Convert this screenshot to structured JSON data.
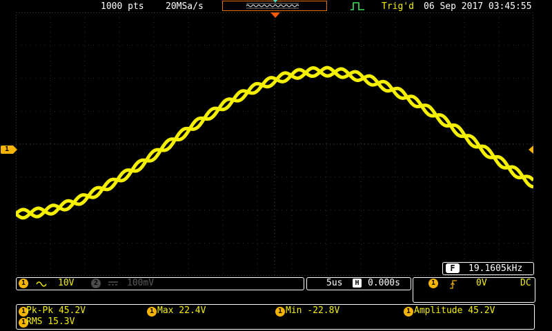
{
  "status_bar": {
    "points": "1000 pts",
    "sample_rate": "20MSa/s",
    "trigger_status": "Trig'd",
    "datetime": "06 Sep 2017 03:45:55"
  },
  "channel_marker": "1",
  "frequency": {
    "icon_label": "F",
    "value": "19.1605kHz"
  },
  "channels": {
    "ch1_label": "1",
    "ch1_coupling_icon": "ac-coupling-icon",
    "ch1_scale": "10V",
    "ch2_label": "2",
    "ch2_coupling_icon": "dc-coupling-icon",
    "ch2_scale": "100mV"
  },
  "timebase": {
    "scale": "5us",
    "horizontal_icon": "H",
    "position": "0.000s"
  },
  "trigger": {
    "source": "1",
    "slope_icon": "rising-edge-icon",
    "level": "0V",
    "coupling": "DC"
  },
  "measurements": [
    {
      "channel": "1",
      "text": "Pk-Pk 45.2V"
    },
    {
      "channel": "1",
      "text": "Max 22.4V"
    },
    {
      "channel": "1",
      "text": "Min -22.8V"
    },
    {
      "channel": "1",
      "text": "Amplitude 45.2V"
    },
    {
      "channel": "1",
      "text": "RMS 15.3V"
    }
  ],
  "colors": {
    "ch1": "#f5f000",
    "ch1_marker": "#f5b400",
    "trigger_marker": "#ff5a00",
    "memory_box": "#e07010",
    "grid": "#5a5a5a",
    "background": "#000000"
  }
}
